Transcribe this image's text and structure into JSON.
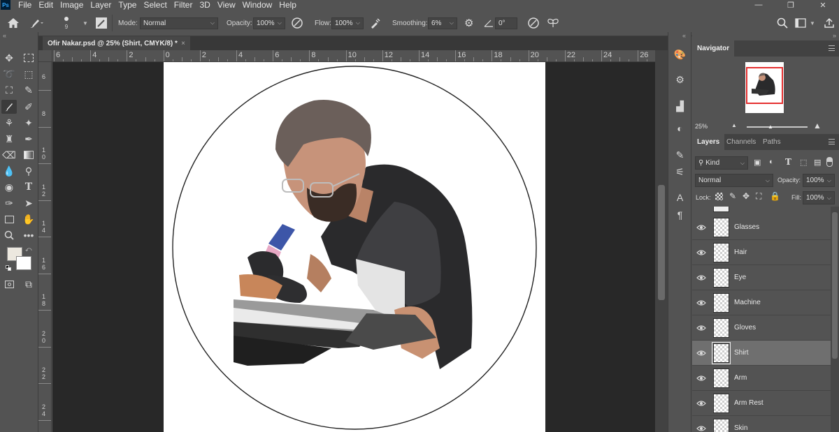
{
  "app": {
    "logo": "Ps"
  },
  "menu": [
    "File",
    "Edit",
    "Image",
    "Layer",
    "Type",
    "Select",
    "Filter",
    "3D",
    "View",
    "Window",
    "Help"
  ],
  "window_controls": {
    "minimize": "—",
    "restore": "❐",
    "close": "✕"
  },
  "options_bar": {
    "brush_size": "9",
    "mode_label": "Mode:",
    "mode_value": "Normal",
    "opacity_label": "Opacity:",
    "opacity_value": "100%",
    "flow_label": "Flow:",
    "flow_value": "100%",
    "smoothing_label": "Smoothing:",
    "smoothing_value": "6%",
    "angle_value": "0°"
  },
  "document_tab": {
    "title": "Ofir Nakar.psd @ 25% (Shirt, CMYK/8) *",
    "close": "×"
  },
  "ruler_h": [
    "6",
    "4",
    "2",
    "0",
    "2",
    "4",
    "6",
    "8",
    "10",
    "12",
    "14",
    "16",
    "18",
    "20",
    "22",
    "24",
    "26"
  ],
  "ruler_v": [
    "6",
    "8",
    "1 0",
    "1 2",
    "1 4",
    "1 6",
    "1 8",
    "2 0",
    "2 2",
    "2 4"
  ],
  "navigator": {
    "title": "Navigator",
    "zoom": "25%"
  },
  "layers_panel": {
    "tabs": [
      "Layers",
      "Channels",
      "Paths"
    ],
    "filter_kind": "Kind",
    "blend_mode": "Normal",
    "opacity_label": "Opacity:",
    "opacity_value": "100%",
    "lock_label": "Lock:",
    "fill_label": "Fill:",
    "fill_value": "100%",
    "layers": [
      {
        "name": "Glasses",
        "selected": false
      },
      {
        "name": "Hair",
        "selected": false
      },
      {
        "name": "Eye",
        "selected": false
      },
      {
        "name": "Machine",
        "selected": false
      },
      {
        "name": "Gloves",
        "selected": false
      },
      {
        "name": "Shirt",
        "selected": true
      },
      {
        "name": "Arm",
        "selected": false
      },
      {
        "name": "Arm Rest",
        "selected": false
      },
      {
        "name": "Skin",
        "selected": false
      }
    ]
  },
  "colors": {
    "foreground": "#ece8df",
    "background": "#ffffff",
    "accent_red": "#e53030"
  }
}
